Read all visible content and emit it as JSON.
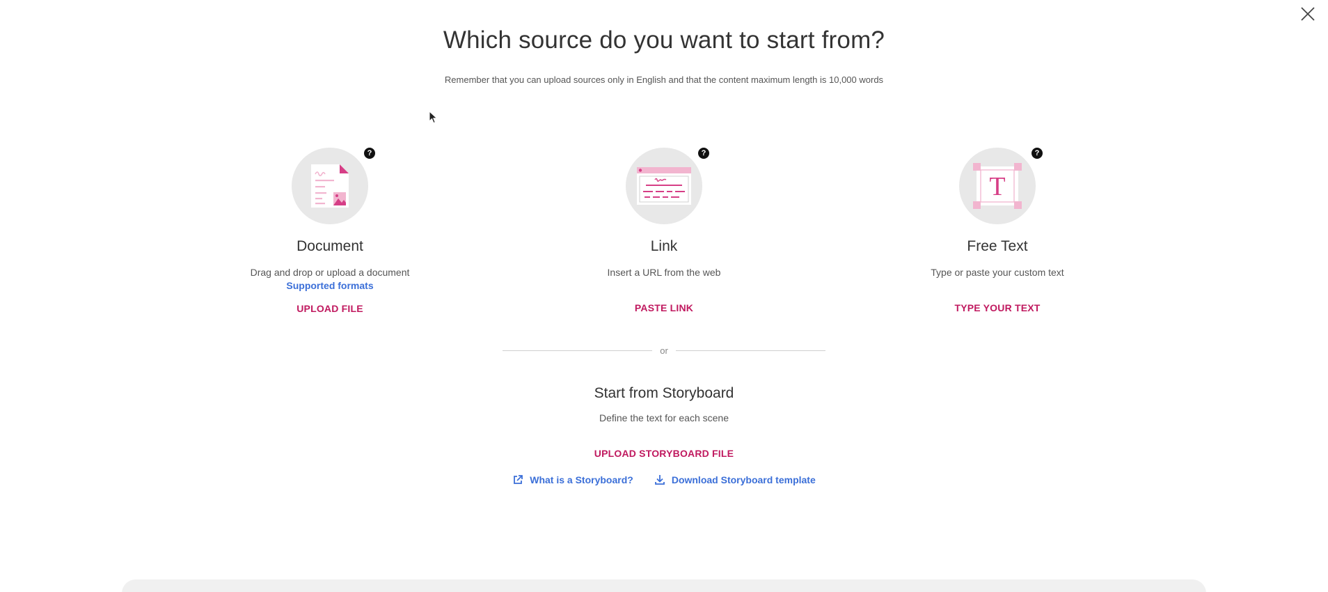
{
  "header": {
    "title": "Which source do you want to start from?",
    "subtitle": "Remember that you can upload sources only in English and that the content maximum length is 10,000 words"
  },
  "options": [
    {
      "title": "Document",
      "description": "Drag and drop or upload a document",
      "link": "Supported formats",
      "action": "UPLOAD FILE",
      "icon": "document-icon"
    },
    {
      "title": "Link",
      "description": "Insert a URL from the web",
      "action": "PASTE LINK",
      "icon": "webpage-icon"
    },
    {
      "title": "Free Text",
      "description": "Type or paste your custom text",
      "action": "TYPE YOUR TEXT",
      "icon": "text-icon"
    }
  ],
  "help_glyph": "?",
  "divider": {
    "label": "or"
  },
  "storyboard": {
    "title": "Start from Storyboard",
    "description": "Define the text for each scene",
    "action": "UPLOAD STORYBOARD FILE",
    "links": [
      {
        "label": "What is a Storyboard?",
        "icon": "external-link-icon"
      },
      {
        "label": "Download Storyboard template",
        "icon": "download-icon"
      }
    ]
  },
  "colors": {
    "accent": "#c0195f",
    "link": "#3b6fd8",
    "icon_pink": "#d63e86",
    "icon_pink_light": "#f2b5cf",
    "icon_bg": "#e8e8e8"
  }
}
